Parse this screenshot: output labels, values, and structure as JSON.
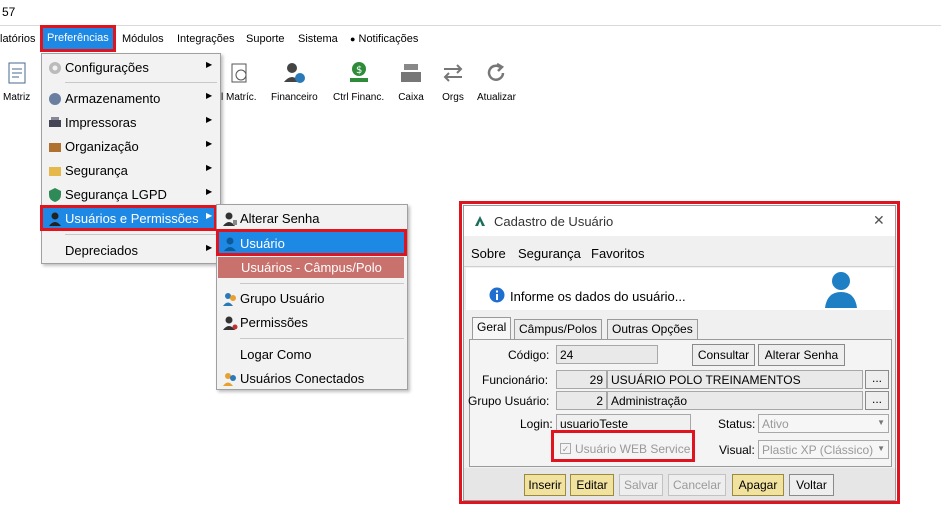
{
  "window": {
    "title_fragment": "57"
  },
  "menubar": {
    "items": [
      "latórios",
      "Preferências",
      "Módulos",
      "Integrações",
      "Suporte",
      "Sistema",
      "Notificações"
    ]
  },
  "toolbar": {
    "items": [
      "Matriz",
      "l Matríc.",
      "Financeiro",
      "Ctrl Financ.",
      "Caixa",
      "Orgs",
      "Atualizar"
    ]
  },
  "preferences_menu": {
    "items": [
      "Configurações",
      "Armazenamento",
      "Impressoras",
      "Organização",
      "Segurança",
      "Segurança LGPD",
      "Usuários e Permissões",
      "Depreciados"
    ]
  },
  "users_submenu": {
    "items": [
      "Alterar Senha",
      "Usuário",
      "Usuários - Câmpus/Polo",
      "Grupo Usuário",
      "Permissões",
      "Logar Como",
      "Usuários Conectados"
    ]
  },
  "dialog": {
    "title": "Cadastro de Usuário",
    "close": "✕",
    "menu": [
      "Sobre",
      "Segurança",
      "Favoritos"
    ],
    "info": "Informe os dados do usuário...",
    "tabs": [
      "Geral",
      "Câmpus/Polos",
      "Outras Opções"
    ],
    "labels": {
      "codigo": "Código:",
      "funcionario": "Funcionário:",
      "grupo": "Grupo Usuário:",
      "login": "Login:",
      "status": "Status:",
      "visual": "Visual:"
    },
    "values": {
      "codigo": "24",
      "funcionario_id": "29",
      "funcionario_name": "USUÁRIO POLO TREINAMENTOS",
      "grupo_id": "2",
      "grupo_name": "Administração",
      "login": "usuarioTeste",
      "status": "Ativo",
      "visual": "Plastic XP (Clássico)",
      "webservice": "Usuário WEB Service"
    },
    "lookup": "...",
    "buttons": {
      "consultar": "Consultar",
      "alterar_senha": "Alterar Senha",
      "inserir": "Inserir",
      "editar": "Editar",
      "salvar": "Salvar",
      "cancelar": "Cancelar",
      "apagar": "Apagar",
      "voltar": "Voltar"
    }
  },
  "colors": {
    "highlight": "#1e88e5",
    "annotation": "#e0141e",
    "submenu_band": "#c9716c"
  }
}
